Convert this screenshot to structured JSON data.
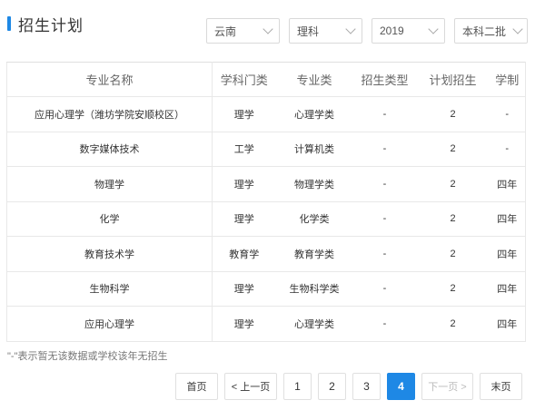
{
  "header": {
    "title": "招生计划"
  },
  "filters": {
    "province": "云南",
    "subject": "理科",
    "year": "2019",
    "batch": "本科二批"
  },
  "table": {
    "columns": [
      "专业名称",
      "学科门类",
      "专业类",
      "招生类型",
      "计划招生",
      "学制"
    ],
    "rows": [
      [
        "应用心理学（潍坊学院安顺校区）",
        "理学",
        "心理学类",
        "-",
        "2",
        "-"
      ],
      [
        "数字媒体技术",
        "工学",
        "计算机类",
        "-",
        "2",
        "-"
      ],
      [
        "物理学",
        "理学",
        "物理学类",
        "-",
        "2",
        "四年"
      ],
      [
        "化学",
        "理学",
        "化学类",
        "-",
        "2",
        "四年"
      ],
      [
        "教育技术学",
        "教育学",
        "教育学类",
        "-",
        "2",
        "四年"
      ],
      [
        "生物科学",
        "理学",
        "生物科学类",
        "-",
        "2",
        "四年"
      ],
      [
        "应用心理学",
        "理学",
        "心理学类",
        "-",
        "2",
        "四年"
      ]
    ]
  },
  "note": "\"-\"表示暂无该数据或学校该年无招生",
  "pagination": {
    "first": "首页",
    "prev": "< 上一页",
    "pages": [
      "1",
      "2",
      "3",
      "4"
    ],
    "current": "4",
    "next": "下一页 >",
    "last": "末页"
  },
  "colors": {
    "accent": "#1e88e5",
    "border": "#e8e8e8"
  },
  "icons": {
    "select_arrow": "chevron-down-icon"
  }
}
